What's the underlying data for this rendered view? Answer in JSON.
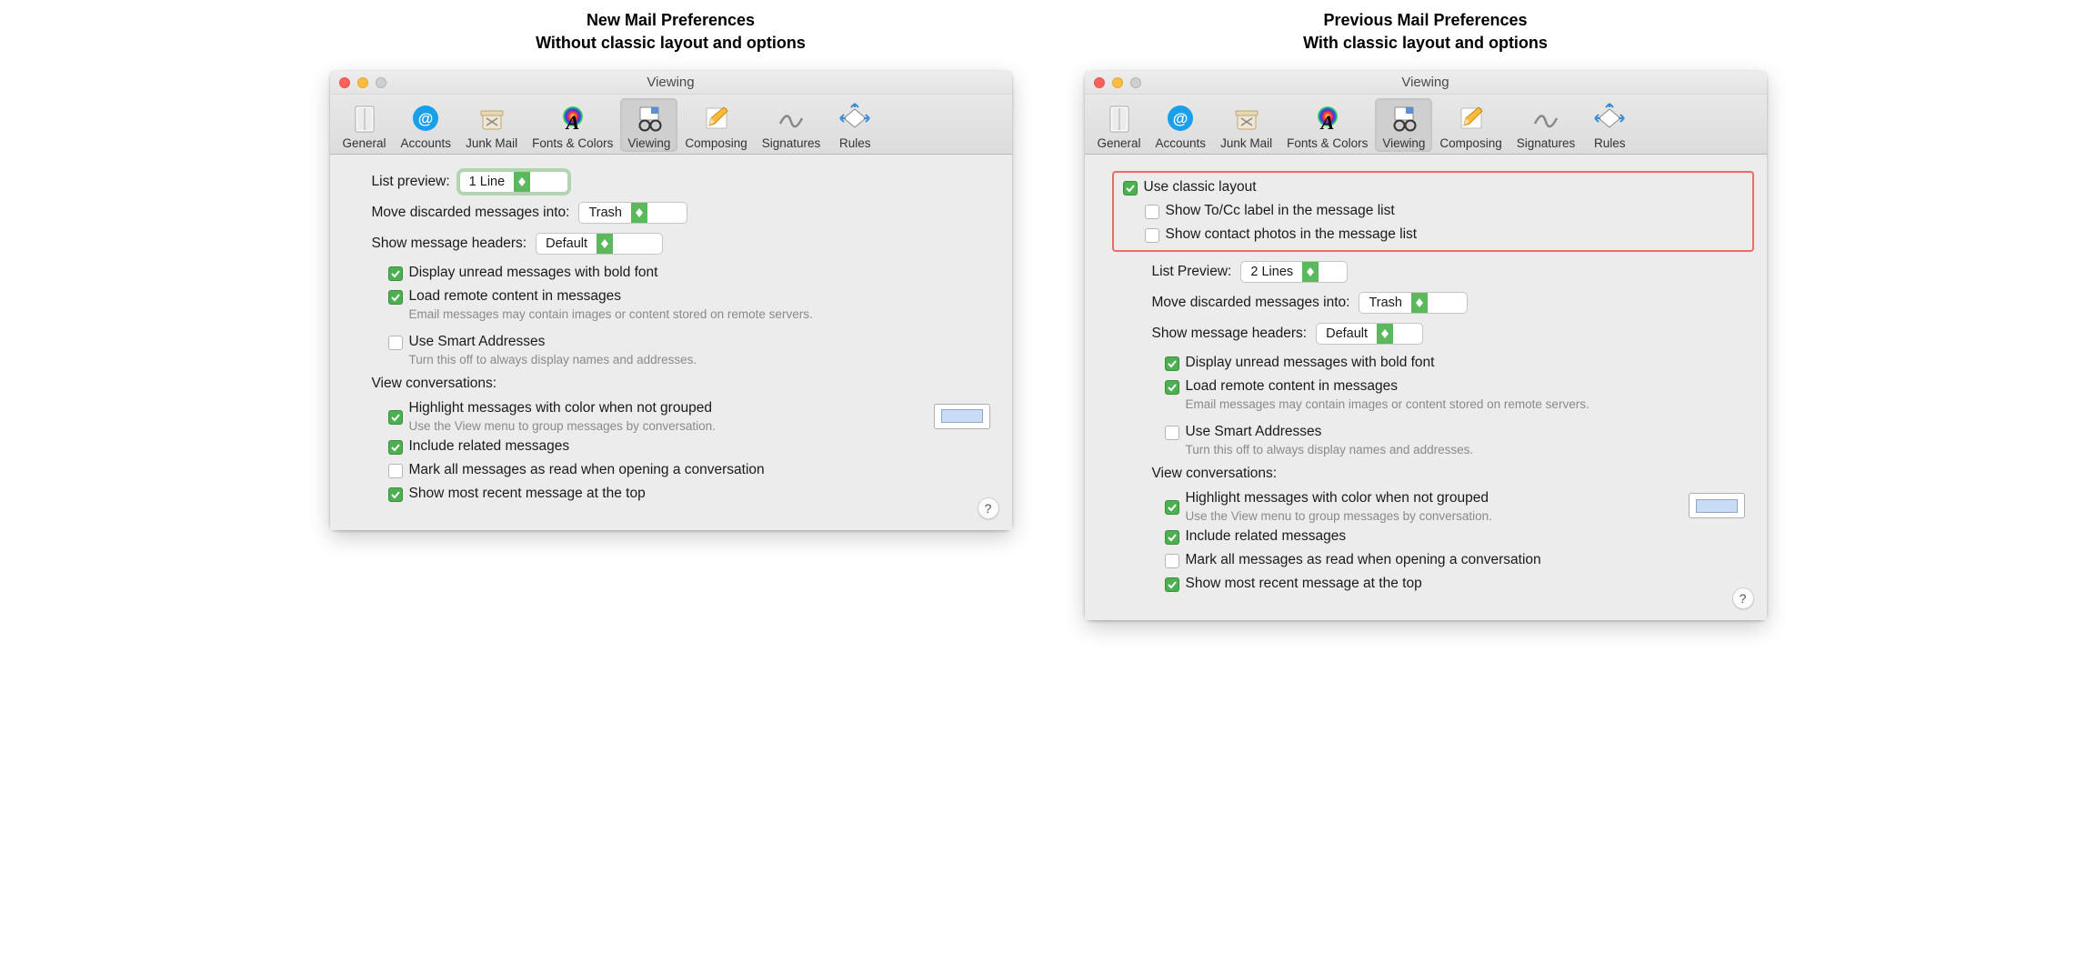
{
  "left": {
    "caption_line1": "New Mail Preferences",
    "caption_line2": "Without classic layout and options",
    "window_title": "Viewing",
    "toolbar": {
      "general": "General",
      "accounts": "Accounts",
      "junk": "Junk Mail",
      "fonts": "Fonts & Colors",
      "viewing": "Viewing",
      "composing": "Composing",
      "signatures": "Signatures",
      "rules": "Rules"
    },
    "list_preview_label": "List preview:",
    "list_preview_value": "1 Line",
    "move_discarded_label": "Move discarded messages into:",
    "move_discarded_value": "Trash",
    "show_headers_label": "Show message headers:",
    "show_headers_value": "Default",
    "display_unread": "Display unread messages with bold font",
    "load_remote": "Load remote content in messages",
    "load_remote_hint": "Email messages may contain images or content stored on remote servers.",
    "smart_addresses": "Use Smart Addresses",
    "smart_hint": "Turn this off to always display names and addresses.",
    "view_conv_label": "View conversations:",
    "highlight": "Highlight messages with color when not grouped",
    "highlight_hint": "Use the View menu to group messages by conversation.",
    "include_related": "Include related messages",
    "mark_all_read": "Mark all messages as read when opening a conversation",
    "show_recent_top": "Show most recent message at the top",
    "help": "?"
  },
  "right": {
    "caption_line1": "Previous Mail Preferences",
    "caption_line2": "With classic layout and options",
    "window_title": "Viewing",
    "toolbar": {
      "general": "General",
      "accounts": "Accounts",
      "junk": "Junk Mail",
      "fonts": "Fonts & Colors",
      "viewing": "Viewing",
      "composing": "Composing",
      "signatures": "Signatures",
      "rules": "Rules"
    },
    "use_classic": "Use classic layout",
    "show_to_cc": "Show To/Cc label in the message list",
    "show_photos": "Show contact photos in the message list",
    "list_preview_label": "List Preview:",
    "list_preview_value": "2 Lines",
    "move_discarded_label": "Move discarded messages into:",
    "move_discarded_value": "Trash",
    "show_headers_label": "Show message headers:",
    "show_headers_value": "Default",
    "display_unread": "Display unread messages with bold font",
    "load_remote": "Load remote content in messages",
    "load_remote_hint": "Email messages may contain images or content stored on remote servers.",
    "smart_addresses": "Use Smart Addresses",
    "smart_hint": "Turn this off to always display names and addresses.",
    "view_conv_label": "View conversations:",
    "highlight": "Highlight messages with color when not grouped",
    "highlight_hint": "Use the View menu to group messages by conversation.",
    "include_related": "Include related messages",
    "mark_all_read": "Mark all messages as read when opening a conversation",
    "show_recent_top": "Show most recent message at the top",
    "help": "?"
  }
}
